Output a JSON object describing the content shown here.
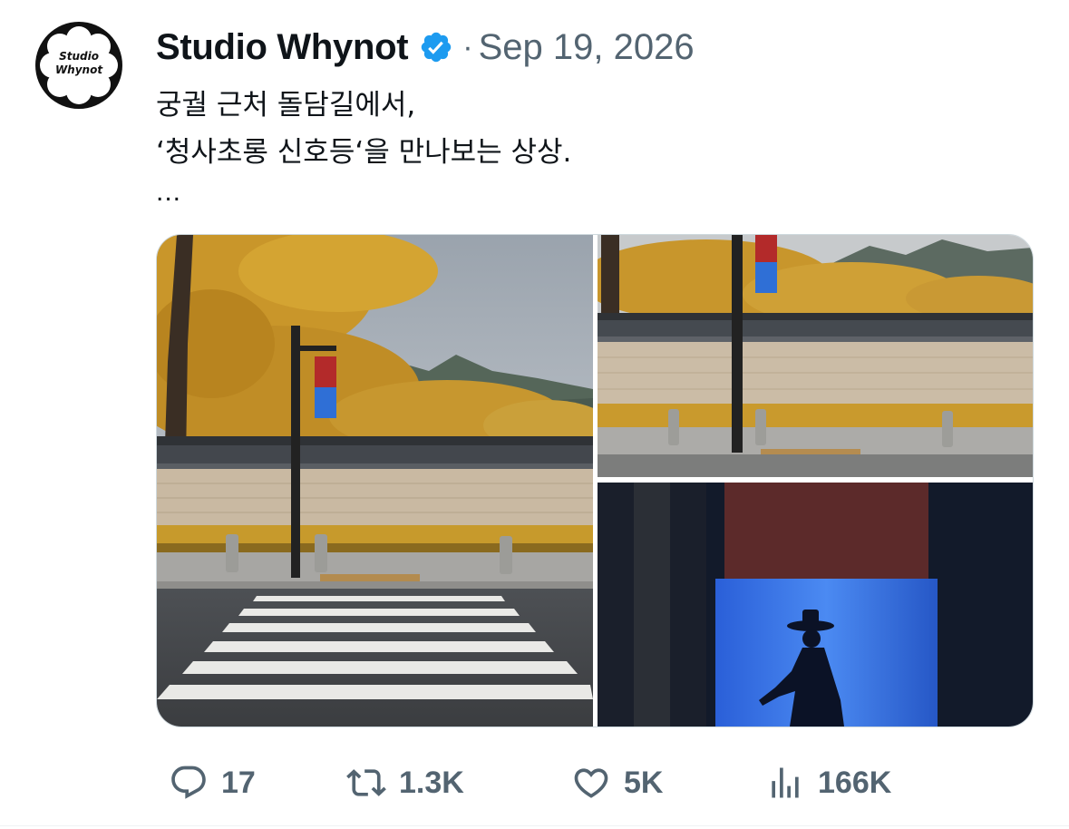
{
  "author": {
    "avatar_text_line1": "Studio",
    "avatar_text_line2": "Whynot",
    "display_name": "Studio Whynot",
    "verified_icon": "verified-badge-icon",
    "separator": "·",
    "date": "Sep 19, 2026"
  },
  "post": {
    "lines": [
      "궁궐 근처 돌담길에서,",
      "‘청사초롱 신호등‘을 만나보는 상상."
    ],
    "more": "..."
  },
  "media": {
    "images": [
      {
        "icon": "crosswalk-street-photo"
      },
      {
        "icon": "stone-wall-lantern-photo"
      },
      {
        "icon": "lantern-closeup-photo"
      }
    ]
  },
  "actions": {
    "replies": "17",
    "reposts": "1.3K",
    "likes": "5K",
    "views": "166K"
  },
  "colors": {
    "verified": "#1d9bf0",
    "muted": "#536471",
    "text": "#0f1419"
  }
}
